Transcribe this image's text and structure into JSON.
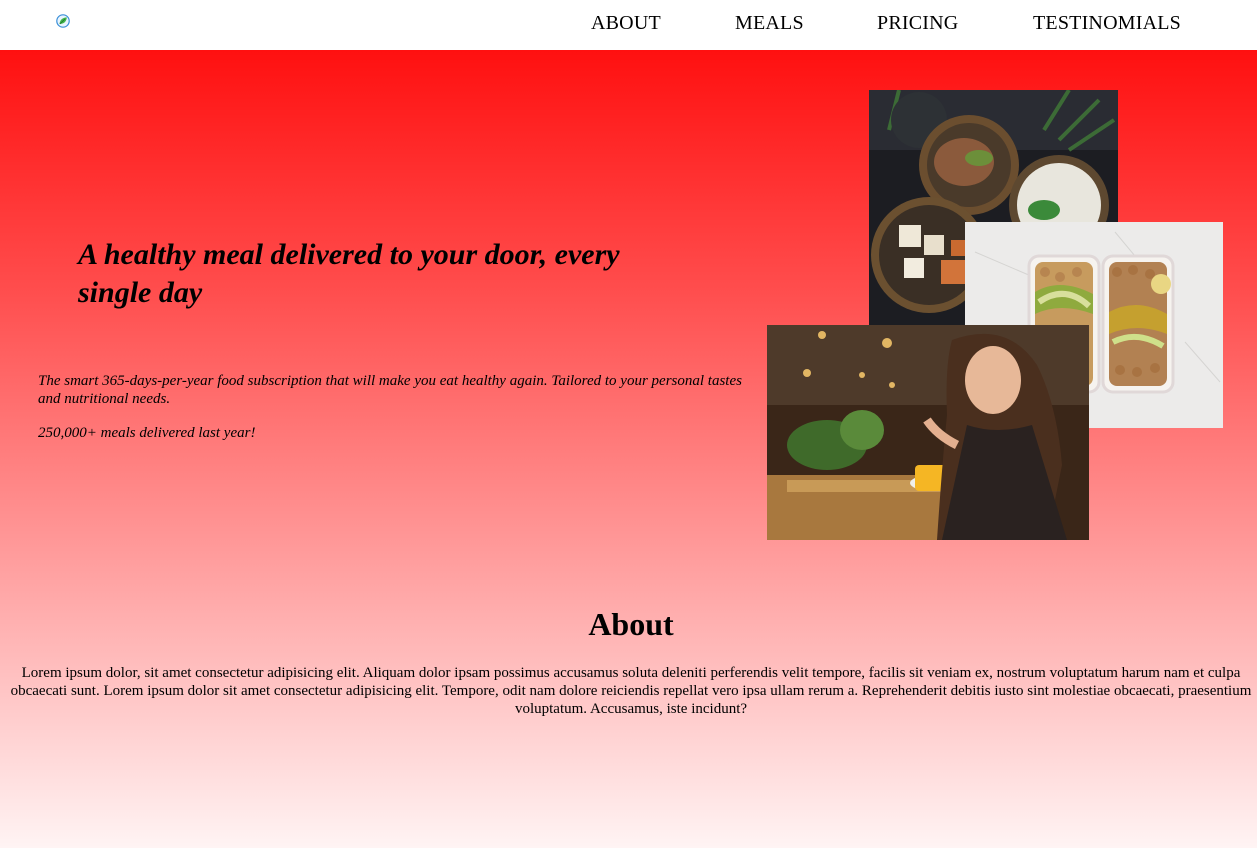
{
  "nav": {
    "logo_icon": "leaf-logo-icon",
    "items": [
      {
        "label": "ABOUT"
      },
      {
        "label": "MEALS"
      },
      {
        "label": "PRICING"
      },
      {
        "label": "TESTINOMIALS"
      }
    ]
  },
  "hero": {
    "title": "A healthy meal delivered to your door, every single day",
    "description": "The smart 365-days-per-year food subscription that will make you eat healthy again. Tailored to your personal tastes and nutritional needs.",
    "stat": "250,000+ meals delivered last year!",
    "background_top": "#ff1010",
    "background_bottom": "#fff4f4"
  },
  "about": {
    "heading": "About",
    "text": "Lorem ipsum dolor, sit amet consectetur adipisicing elit. Aliquam dolor ipsam possimus accusamus soluta deleniti perferendis velit tempore, facilis sit veniam ex, nostrum voluptatum harum nam et culpa obcaecati sunt. Lorem ipsum dolor sit amet consectetur adipisicing elit. Tempore, odit nam dolore reiciendis repellat vero ipsa ullam rerum a. Reprehenderit debitis iusto sint molestiae obcaecati, praesentium voluptatum. Accusamus, iste incidunt?"
  }
}
